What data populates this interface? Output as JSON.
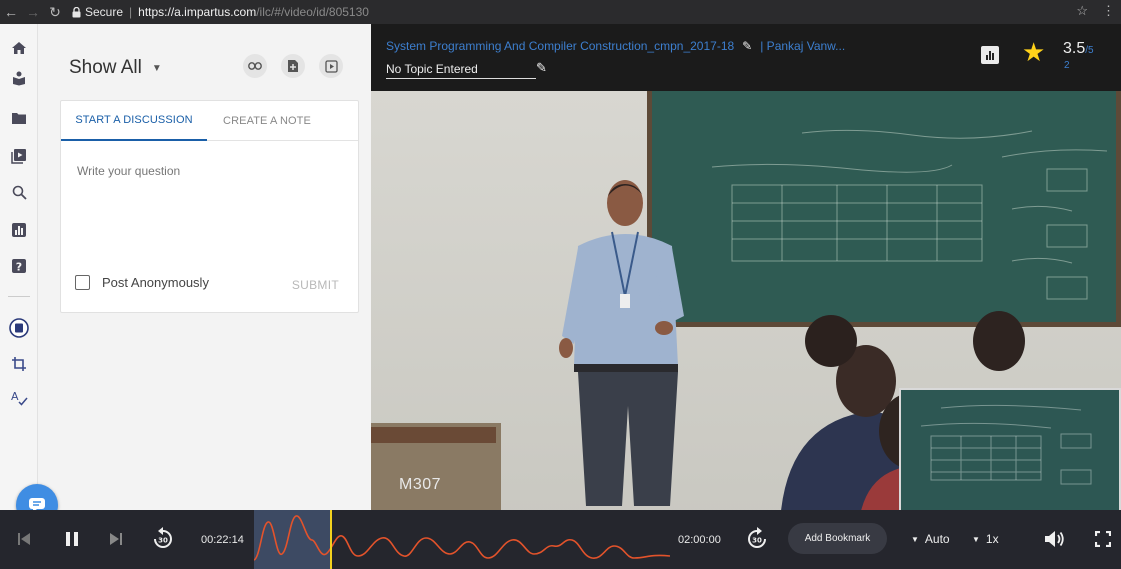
{
  "browser": {
    "secure_label": "Secure",
    "url_main": "https://a.impartus.com",
    "url_rest": "/ilc/#/video/id/805130"
  },
  "panel": {
    "filter_label": "Show All",
    "tabs": [
      {
        "label": "START A DISCUSSION",
        "active": true
      },
      {
        "label": "CREATE A NOTE",
        "active": false
      }
    ],
    "question_placeholder": "Write your question",
    "anonymous_label": "Post Anonymously",
    "submit_label": "SUBMIT"
  },
  "video": {
    "title": "System Programming And Compiler Construction_cmpn_2017-18",
    "presenter": "| Pankaj Vanw...",
    "topic": "No Topic Entered",
    "rating": "3.5",
    "rating_max": "/5",
    "rating_count": "2",
    "room_label": "M307"
  },
  "controls": {
    "current_time": "00:22:14",
    "total_time": "02:00:00",
    "skip_back_label": "30",
    "skip_forward_label": "30",
    "bookmark_label": "Add Bookmark",
    "quality": "Auto",
    "speed": "1x",
    "progress": 0.185
  },
  "icons": {
    "rail": [
      "home-icon",
      "classes-icon",
      "folder-icon",
      "video-library-icon",
      "search-icon",
      "analytics-icon",
      "help-icon",
      "notes-icon",
      "crop-icon",
      "spellcheck-icon"
    ],
    "accent": "#3d7fcf",
    "star_color": "#ffd21a",
    "timeline_color": "#e3532b",
    "playhead_color": "#f4d21e"
  }
}
